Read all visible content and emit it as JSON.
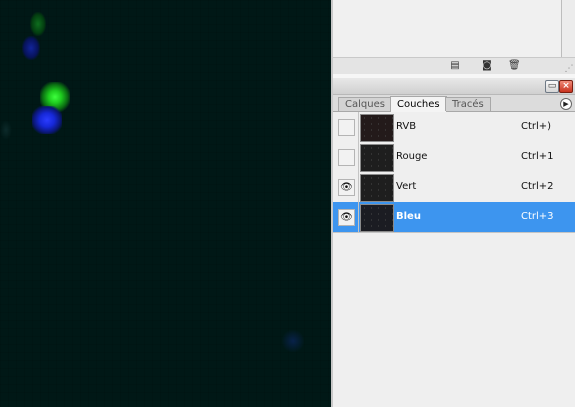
{
  "canvas": {
    "glows": [
      "green-pixel-cluster",
      "blue-pixel-cluster"
    ]
  },
  "upper_panel": {
    "icons": [
      "new-document-icon",
      "camera-icon",
      "trash-icon",
      "resize-grip-icon"
    ]
  },
  "channels_panel": {
    "tabs": [
      {
        "label": "Calques",
        "active": false
      },
      {
        "label": "Couches",
        "active": true
      },
      {
        "label": "Tracés",
        "active": false
      }
    ],
    "channels": [
      {
        "name": "RVB",
        "shortcut": "Ctrl+)",
        "visible": false,
        "selected": false
      },
      {
        "name": "Rouge",
        "shortcut": "Ctrl+1",
        "visible": false,
        "selected": false
      },
      {
        "name": "Vert",
        "shortcut": "Ctrl+2",
        "visible": true,
        "selected": false
      },
      {
        "name": "Bleu",
        "shortcut": "Ctrl+3",
        "visible": true,
        "selected": true
      }
    ]
  },
  "colors": {
    "selection": "#3d95ef",
    "canvas_bg": "#001816"
  }
}
